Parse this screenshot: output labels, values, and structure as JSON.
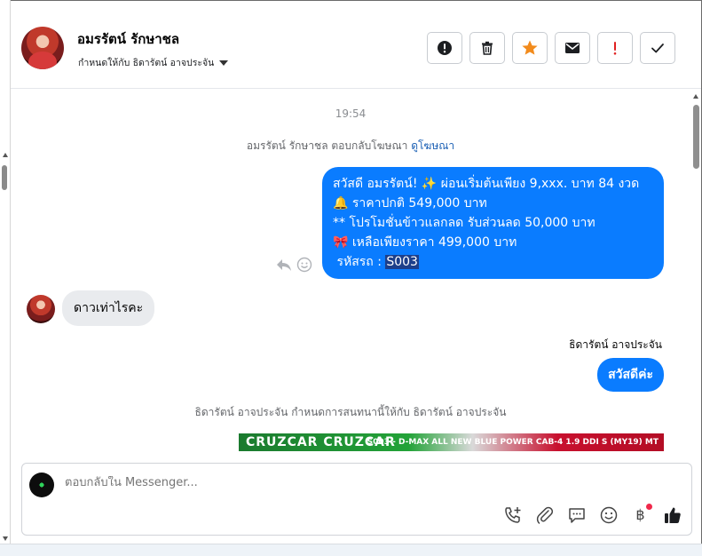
{
  "header": {
    "contact_name": "อมรรัตน์ รักษาชล",
    "assigned_label": "กำหนดให้กับ ธิดารัตน์ อาจประจัน"
  },
  "toolbar": [
    {
      "name": "spam-button",
      "icon": "exclamation-circle-icon"
    },
    {
      "name": "delete-button",
      "icon": "trash-icon"
    },
    {
      "name": "star-button",
      "icon": "star-icon"
    },
    {
      "name": "mark-unread-button",
      "icon": "envelope-icon"
    },
    {
      "name": "follow-up-button",
      "icon": "exclamation-icon"
    },
    {
      "name": "mark-done-button",
      "icon": "check-icon"
    }
  ],
  "colors": {
    "accent": "#0a7cff",
    "star": "#f28b1c",
    "alert": "#e02020"
  },
  "conversation": {
    "time": "19:54",
    "ad_notice": "อมรรัตน์ รักษาชล ตอบกลับโฆษณา",
    "ad_link": "ดูโฆษณา",
    "outgoing_message": {
      "lines": [
        "สวัสดี อมรรัตน์! ✨  ผ่อนเริ่มต้นเพียง 9,xxx. บาท 84 งวด",
        "🔔 ราคาปกติ 549,000 บาท",
        "** โปรโมชั่นข้าวแลกลด รับส่วนลด 50,000 บาท",
        "🎀  เหลือเพียงราคา 499,000 บาท"
      ],
      "code_prefix": " รหัสรถ : ",
      "code_value": "S003"
    },
    "incoming_message": "ดาวเท่าไรคะ",
    "sender_name": "ธิดารัตน์ อาจประจัน",
    "reply_message": "สวัสดีค่ะ",
    "assign_notice": "ธิดารัตน์ อาจประจัน กำหนดการสนทนานี้ให้กับ ธิดารัตน์ อาจประจัน",
    "banner_left": "CRUZCAR CRUZCAR",
    "banner_right": "S003 - D-MAX ALL NEW BLUE POWER CAB-4 1.9 DDI S (MY19) MT"
  },
  "composer": {
    "placeholder": "ตอบกลับใน Messenger...",
    "icons": [
      "phone-plus-icon",
      "paperclip-icon",
      "saved-reply-icon",
      "emoji-icon",
      "baht-icon",
      "like-icon"
    ],
    "baht_symbol": "฿"
  }
}
